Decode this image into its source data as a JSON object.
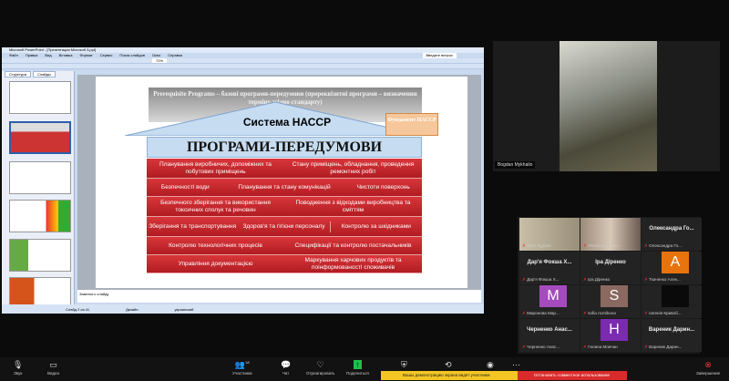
{
  "ppt": {
    "title": "Microsoft PowerPoint - [Презентация Microsoft 3.ppt]",
    "menu": [
      "Файл",
      "Правка",
      "Вид",
      "Вставка",
      "Формат",
      "Сервис",
      "Показ слайдов",
      "Окно",
      "Справка"
    ],
    "zoom": "72%",
    "tabs": [
      "Структура",
      "Слайды"
    ],
    "notes": "Заметки к слайду",
    "status": [
      "Слайд 2 из 41",
      "Дизайн",
      "украинский"
    ],
    "search_placeholder": "Введите вопрос"
  },
  "slide": {
    "header": "Prerequisite Programs – базові програми-передумови (пререквізитні програми – визначення терміну згідно стандарту)",
    "house_title": "Система НАССР",
    "foundation": "Фундамент НАССР",
    "band": "ПРОГРАМИ-ПЕРЕДУМОВИ",
    "rows": [
      [
        "Планування виробничих, допоміжних та побутових приміщень",
        "Стану приміщень, обладнання, проведення ремонтних робіт"
      ],
      [
        "Безпечності води",
        "Планування та стану комунікацій",
        "Чистоти поверхонь"
      ],
      [
        "Безпечного зберігання та використання токсичних сполук та речовин",
        "Поводження з відходами виробництва та сміттям"
      ],
      [
        "Зберігання та транспортування",
        "Здоров'я та гігієни персоналу",
        "Контролю за шкідниками"
      ],
      [
        "Контролю технологічних процесів",
        "Специфікації та контролю постачальників"
      ],
      [
        "Управління документацією",
        "Маркування харчових продуктів та поінформованості споживачів"
      ]
    ]
  },
  "speaker": {
    "name": "Bogdan Mykhailo"
  },
  "gallery": [
    {
      "label": "Олег Кудаєв",
      "video": true
    },
    {
      "label": "Олександра Ко...",
      "video": true
    },
    {
      "title": "Олександра Го...",
      "label": "Олександра Го..."
    },
    {
      "title": "Дар'я Фокша Х...",
      "label": "Дар'я Фокша Х..."
    },
    {
      "title": "Іра Діренко",
      "label": "Іра Діренко"
    },
    {
      "avatar": "A",
      "color": "#e8730c",
      "label": "Ткаченко Алек..."
    },
    {
      "avatar": "M",
      "color": "#a54bbd",
      "label": "Миронова Мар..."
    },
    {
      "avatar": "S",
      "color": "#8a6a60",
      "label": "sofia roznikova"
    },
    {
      "avatar": "",
      "color": "#0a0a0a",
      "label": "євгенія Кривоб..."
    },
    {
      "title": "Черненко Анас...",
      "label": "Черненко Анас..."
    },
    {
      "avatar": "H",
      "color": "#7b2bb0",
      "label": "Галина Мовчан"
    },
    {
      "title": "Вареник Дарин...",
      "label": "Вареник Дарин..."
    }
  ],
  "toolbar": {
    "audio": "Звук",
    "video": "Видео",
    "participants": "Участники",
    "participants_count": "18",
    "chat": "Чат",
    "react": "Отреагировать",
    "share": "Поделиться",
    "apps": "Приложения",
    "whiteboard": "Доски",
    "record": "Запись",
    "more": "Подробнее",
    "end": "Завершение",
    "notice": "Вашы демонстрацию экрана видят участники",
    "stop_share": "Остановить совместное использование"
  }
}
